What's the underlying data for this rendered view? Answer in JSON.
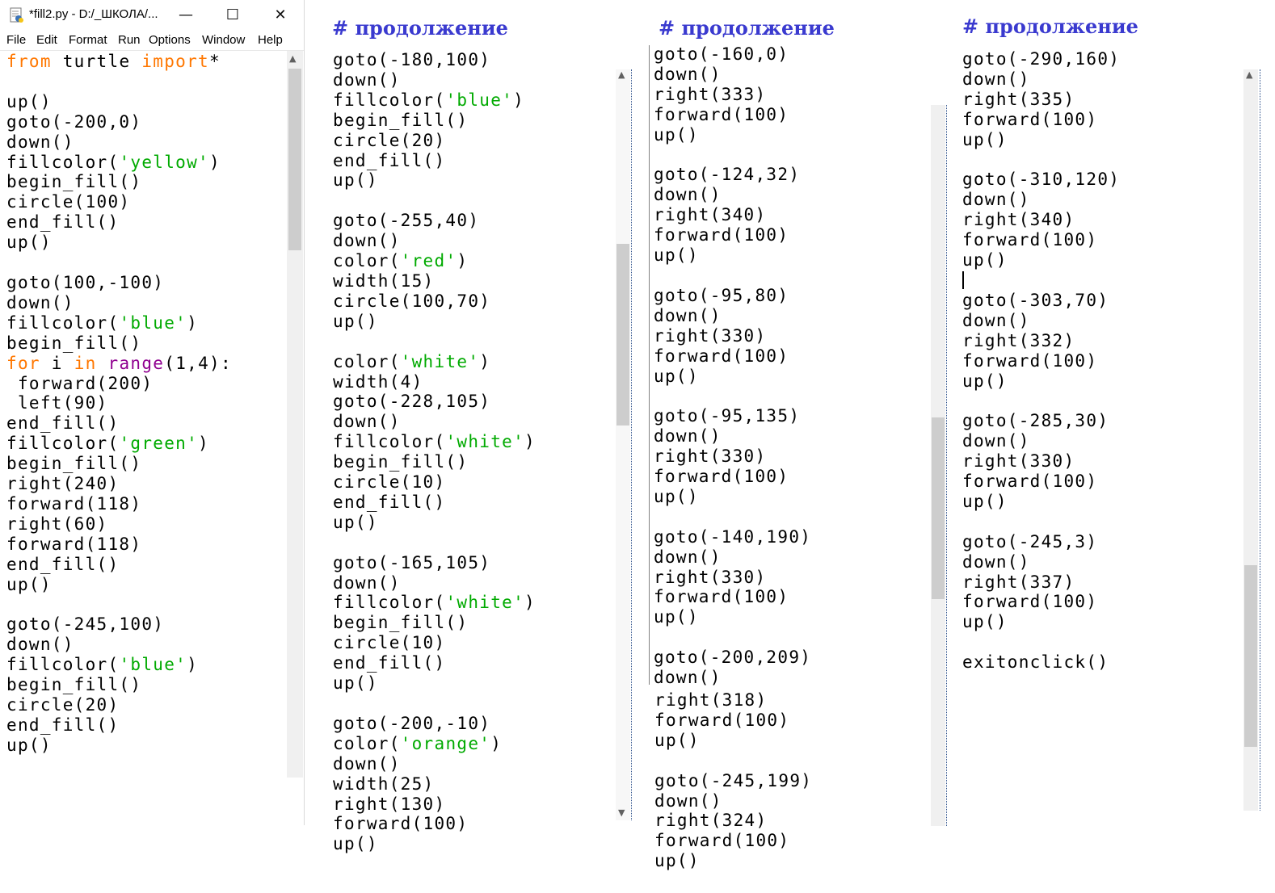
{
  "window": {
    "title": "*fill2.py - D:/_ШКОЛА/...",
    "controls": {
      "minimize": "—",
      "maximize": "☐",
      "close": "✕"
    },
    "menu": [
      "File",
      "Edit",
      "Format",
      "Run",
      "Options",
      "Window",
      "Help"
    ]
  },
  "headings": [
    "#  продолжение",
    "#  продолжение",
    "#  продолжение"
  ],
  "code_panels": [
    {
      "name": "editor",
      "lines": [
        [
          [
            "kw",
            "from"
          ],
          [
            "n",
            " turtle "
          ],
          [
            "kw",
            "import"
          ],
          [
            "n",
            "*"
          ]
        ],
        [],
        [
          [
            "n",
            "up()"
          ]
        ],
        [
          [
            "n",
            "goto(-200,0)"
          ]
        ],
        [
          [
            "n",
            "down()"
          ]
        ],
        [
          [
            "n",
            "fillcolor("
          ],
          [
            "str",
            "'yellow'"
          ],
          [
            "n",
            ")"
          ]
        ],
        [
          [
            "n",
            "begin_fill()"
          ]
        ],
        [
          [
            "n",
            "circle(100)"
          ]
        ],
        [
          [
            "n",
            "end_fill()"
          ]
        ],
        [
          [
            "n",
            "up()"
          ]
        ],
        [],
        [
          [
            "n",
            "goto(100,-100)"
          ]
        ],
        [
          [
            "n",
            "down()"
          ]
        ],
        [
          [
            "n",
            "fillcolor("
          ],
          [
            "str",
            "'blue'"
          ],
          [
            "n",
            ")"
          ]
        ],
        [
          [
            "n",
            "begin_fill()"
          ]
        ],
        [
          [
            "kw",
            "for"
          ],
          [
            "n",
            " i "
          ],
          [
            "kw",
            "in"
          ],
          [
            "n",
            " "
          ],
          [
            "bi",
            "range"
          ],
          [
            "n",
            "(1,4):"
          ]
        ],
        [
          [
            "n",
            " forward(200)"
          ]
        ],
        [
          [
            "n",
            " left(90)"
          ]
        ],
        [
          [
            "n",
            "end_fill()"
          ]
        ],
        [
          [
            "n",
            "fillcolor("
          ],
          [
            "str",
            "'green'"
          ],
          [
            "n",
            ")"
          ]
        ],
        [
          [
            "n",
            "begin_fill()"
          ]
        ],
        [
          [
            "n",
            "right(240)"
          ]
        ],
        [
          [
            "n",
            "forward(118)"
          ]
        ],
        [
          [
            "n",
            "right(60)"
          ]
        ],
        [
          [
            "n",
            "forward(118)"
          ]
        ],
        [
          [
            "n",
            "end_fill()"
          ]
        ],
        [
          [
            "n",
            "up()"
          ]
        ],
        [],
        [
          [
            "n",
            "goto(-245,100)"
          ]
        ],
        [
          [
            "n",
            "down()"
          ]
        ],
        [
          [
            "n",
            "fillcolor("
          ],
          [
            "str",
            "'blue'"
          ],
          [
            "n",
            ")"
          ]
        ],
        [
          [
            "n",
            "begin_fill()"
          ]
        ],
        [
          [
            "n",
            "circle(20)"
          ]
        ],
        [
          [
            "n",
            "end_fill()"
          ]
        ],
        [
          [
            "n",
            "up()"
          ]
        ]
      ]
    },
    {
      "name": "continuation-1",
      "lines": [
        [
          [
            "n",
            "goto(-180,100)"
          ]
        ],
        [
          [
            "n",
            "down()"
          ]
        ],
        [
          [
            "n",
            "fillcolor("
          ],
          [
            "str",
            "'blue'"
          ],
          [
            "n",
            ")"
          ]
        ],
        [
          [
            "n",
            "begin_fill()"
          ]
        ],
        [
          [
            "n",
            "circle(20)"
          ]
        ],
        [
          [
            "n",
            "end_fill()"
          ]
        ],
        [
          [
            "n",
            "up()"
          ]
        ],
        [],
        [
          [
            "n",
            "goto(-255,40)"
          ]
        ],
        [
          [
            "n",
            "down()"
          ]
        ],
        [
          [
            "n",
            "color("
          ],
          [
            "str",
            "'red'"
          ],
          [
            "n",
            ")"
          ]
        ],
        [
          [
            "n",
            "width(15)"
          ]
        ],
        [
          [
            "n",
            "circle(100,70)"
          ]
        ],
        [
          [
            "n",
            "up()"
          ]
        ],
        [],
        [
          [
            "n",
            "color("
          ],
          [
            "str",
            "'white'"
          ],
          [
            "n",
            ")"
          ]
        ],
        [
          [
            "n",
            "width(4)"
          ]
        ],
        [
          [
            "n",
            "goto(-228,105)"
          ]
        ],
        [
          [
            "n",
            "down()"
          ]
        ],
        [
          [
            "n",
            "fillcolor("
          ],
          [
            "str",
            "'white'"
          ],
          [
            "n",
            ")"
          ]
        ],
        [
          [
            "n",
            "begin_fill()"
          ]
        ],
        [
          [
            "n",
            "circle(10)"
          ]
        ],
        [
          [
            "n",
            "end_fill()"
          ]
        ],
        [
          [
            "n",
            "up()"
          ]
        ],
        [],
        [
          [
            "n",
            "goto(-165,105)"
          ]
        ],
        [
          [
            "n",
            "down()"
          ]
        ],
        [
          [
            "n",
            "fillcolor("
          ],
          [
            "str",
            "'white'"
          ],
          [
            "n",
            ")"
          ]
        ],
        [
          [
            "n",
            "begin_fill()"
          ]
        ],
        [
          [
            "n",
            "circle(10)"
          ]
        ],
        [
          [
            "n",
            "end_fill()"
          ]
        ],
        [
          [
            "n",
            "up()"
          ]
        ],
        [],
        [
          [
            "n",
            "goto(-200,-10)"
          ]
        ],
        [
          [
            "n",
            "color("
          ],
          [
            "str",
            "'orange'"
          ],
          [
            "n",
            ")"
          ]
        ],
        [
          [
            "n",
            "down()"
          ]
        ],
        [
          [
            "n",
            "width(25)"
          ]
        ],
        [
          [
            "n",
            "right(130)"
          ]
        ],
        [
          [
            "n",
            "forward(100)"
          ]
        ],
        [
          [
            "n",
            "up()"
          ]
        ]
      ]
    },
    {
      "name": "continuation-2",
      "lines": [
        [
          [
            "n",
            "goto(-160,0)"
          ]
        ],
        [
          [
            "n",
            "down()"
          ]
        ],
        [
          [
            "n",
            "right(333)"
          ]
        ],
        [
          [
            "n",
            "forward(100)"
          ]
        ],
        [
          [
            "n",
            "up()"
          ]
        ],
        [],
        [
          [
            "n",
            "goto(-124,32)"
          ]
        ],
        [
          [
            "n",
            "down()"
          ]
        ],
        [
          [
            "n",
            "right(340)"
          ]
        ],
        [
          [
            "n",
            "forward(100)"
          ]
        ],
        [
          [
            "n",
            "up()"
          ]
        ],
        [],
        [
          [
            "n",
            "goto(-95,80)"
          ]
        ],
        [
          [
            "n",
            "down()"
          ]
        ],
        [
          [
            "n",
            "right(330)"
          ]
        ],
        [
          [
            "n",
            "forward(100)"
          ]
        ],
        [
          [
            "n",
            "up()"
          ]
        ],
        [],
        [
          [
            "n",
            "goto(-95,135)"
          ]
        ],
        [
          [
            "n",
            "down()"
          ]
        ],
        [
          [
            "n",
            "right(330)"
          ]
        ],
        [
          [
            "n",
            "forward(100)"
          ]
        ],
        [
          [
            "n",
            "up()"
          ]
        ],
        [],
        [
          [
            "n",
            "goto(-140,190)"
          ]
        ],
        [
          [
            "n",
            "down()"
          ]
        ],
        [
          [
            "n",
            "right(330)"
          ]
        ],
        [
          [
            "n",
            "forward(100)"
          ]
        ],
        [
          [
            "n",
            "up()"
          ]
        ],
        [],
        [
          [
            "n",
            "goto(-200,209)"
          ]
        ],
        [
          [
            "n",
            "down()"
          ]
        ]
      ]
    },
    {
      "name": "continuation-2b",
      "lines": [
        [
          [
            "n",
            "right(318)"
          ]
        ],
        [
          [
            "n",
            "forward(100)"
          ]
        ],
        [
          [
            "n",
            "up()"
          ]
        ],
        [],
        [
          [
            "n",
            "goto(-245,199)"
          ]
        ],
        [
          [
            "n",
            "down()"
          ]
        ],
        [
          [
            "n",
            "right(324)"
          ]
        ],
        [
          [
            "n",
            "forward(100)"
          ]
        ],
        [
          [
            "n",
            "up()"
          ]
        ]
      ]
    },
    {
      "name": "continuation-3",
      "lines": [
        [
          [
            "n",
            "goto(-290,160)"
          ]
        ],
        [
          [
            "n",
            "down()"
          ]
        ],
        [
          [
            "n",
            "right(335)"
          ]
        ],
        [
          [
            "n",
            "forward(100)"
          ]
        ],
        [
          [
            "n",
            "up()"
          ]
        ],
        [],
        [
          [
            "n",
            "goto(-310,120)"
          ]
        ],
        [
          [
            "n",
            "down()"
          ]
        ],
        [
          [
            "n",
            "right(340)"
          ]
        ],
        [
          [
            "n",
            "forward(100)"
          ]
        ],
        [
          [
            "n",
            "up()"
          ]
        ],
        [],
        [
          [
            "n",
            "goto(-303,70)"
          ]
        ],
        [
          [
            "n",
            "down()"
          ]
        ],
        [
          [
            "n",
            "right(332)"
          ]
        ],
        [
          [
            "n",
            "forward(100)"
          ]
        ],
        [
          [
            "n",
            "up()"
          ]
        ],
        [],
        [
          [
            "n",
            "goto(-285,30)"
          ]
        ],
        [
          [
            "n",
            "down()"
          ]
        ],
        [
          [
            "n",
            "right(330)"
          ]
        ],
        [
          [
            "n",
            "forward(100)"
          ]
        ],
        [
          [
            "n",
            "up()"
          ]
        ],
        [],
        [
          [
            "n",
            "goto(-245,3)"
          ]
        ],
        [
          [
            "n",
            "down()"
          ]
        ],
        [
          [
            "n",
            "right(337)"
          ]
        ],
        [
          [
            "n",
            "forward(100)"
          ]
        ],
        [
          [
            "n",
            "up()"
          ]
        ],
        [],
        [
          [
            "n",
            "exitonclick()"
          ]
        ]
      ]
    }
  ],
  "scrollbar_arrows": {
    "up": "▲",
    "down": "▼"
  },
  "colors": {
    "keyword": "#ff7700",
    "builtin": "#900090",
    "string": "#00aa00",
    "heading": "#3a3acf"
  }
}
